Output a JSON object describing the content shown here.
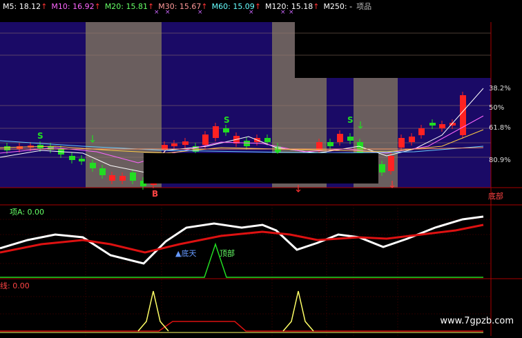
{
  "ma_legend": [
    {
      "label": "M5: 18.12",
      "arrow": "↑",
      "color": "#ffffff"
    },
    {
      "label": "M10: 16.92",
      "arrow": "↑",
      "color": "#ff66ff"
    },
    {
      "label": "M20: 15.81",
      "arrow": "↑",
      "color": "#66ff66"
    },
    {
      "label": "M30: 15.67",
      "arrow": "↑",
      "color": "#ff9999"
    },
    {
      "label": "M60: 15.09",
      "arrow": "↑",
      "color": "#66ffff"
    },
    {
      "label": "M120: 15.18",
      "arrow": "↑",
      "color": "#ffffff"
    },
    {
      "label": "M250: -",
      "arrow": "",
      "color": "#ffffff"
    },
    {
      "label": "项品",
      "arrow": "",
      "color": "#bbbbbb"
    }
  ],
  "price_levels": [
    {
      "label": "38.2%",
      "color": "#dddddd"
    },
    {
      "label": "50%",
      "color": "#dddddd"
    },
    {
      "label": "61.8%",
      "color": "#dddddd"
    },
    {
      "label": "80.9%",
      "color": "#dddddd"
    }
  ],
  "signals": {
    "buy_label": "B",
    "sell_label": "S",
    "bottom_zone_label": "底部"
  },
  "panel2": {
    "title": "项A: 0.00",
    "bottom_label": "▲底天",
    "top_label": "顶部"
  },
  "panel3": {
    "title": "线: 0.00"
  },
  "watermark": "www.7gpzb.com",
  "colors": {
    "up": "#ff2222",
    "down": "#22dd22",
    "purple": "#1a0a66",
    "gray": "#6a5e5e",
    "border": "#aa0000"
  }
}
